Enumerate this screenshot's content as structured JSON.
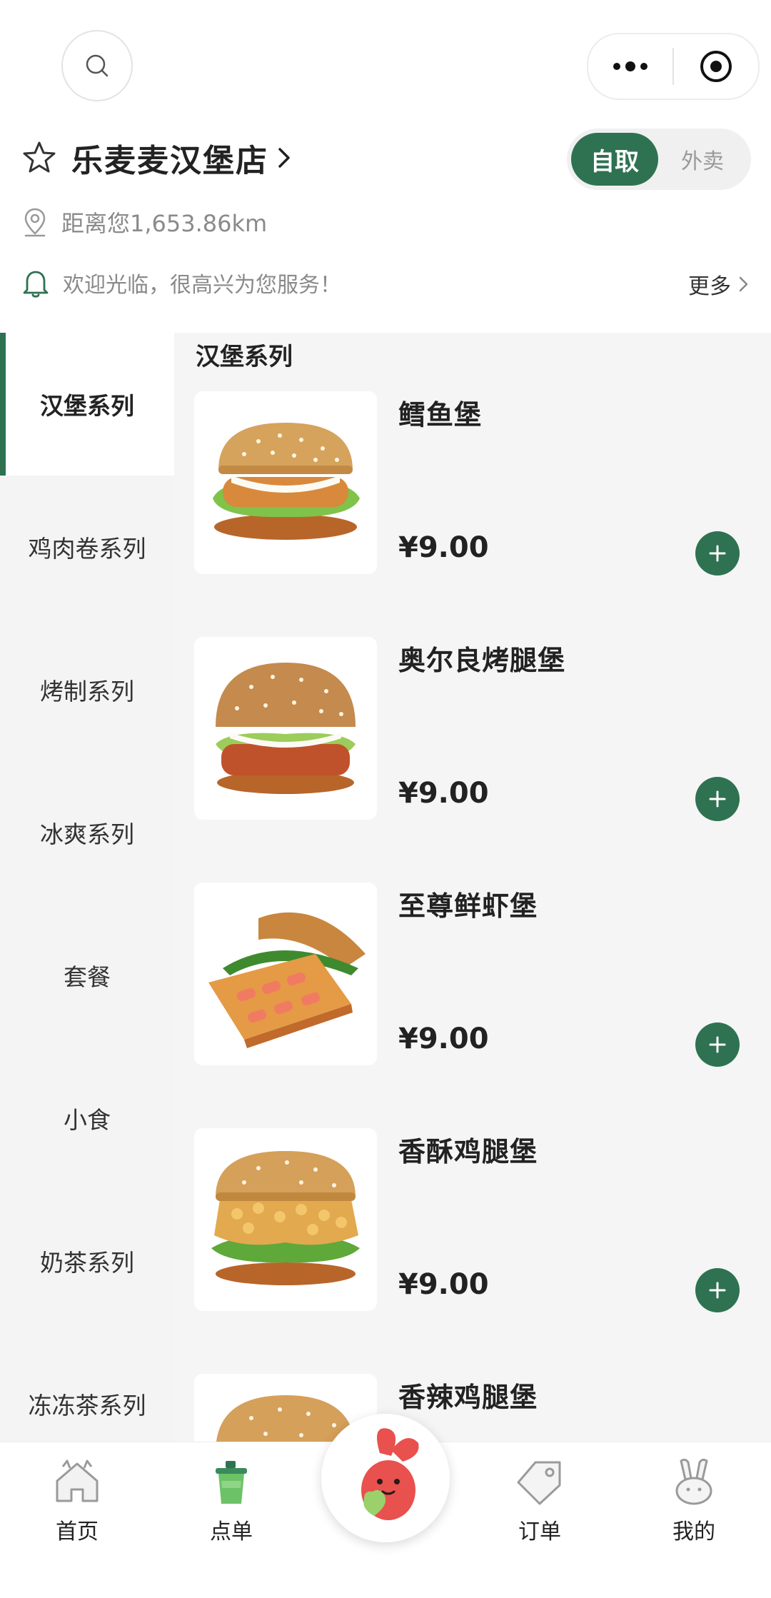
{
  "store": {
    "name": "乐麦麦汉堡店",
    "distance": "距离您1,653.86km",
    "notice": "欢迎光临，很高兴为您服务！",
    "more_label": "更多"
  },
  "mode_toggle": {
    "active": "自取",
    "inactive": "外卖"
  },
  "sidebar": {
    "categories": [
      {
        "label": "汉堡系列",
        "active": true
      },
      {
        "label": "鸡肉卷系列"
      },
      {
        "label": "烤制系列"
      },
      {
        "label": "冰爽系列"
      },
      {
        "label": "套餐"
      },
      {
        "label": "小食"
      },
      {
        "label": "奶茶系列"
      },
      {
        "label": "冻冻茶系列"
      }
    ]
  },
  "menu": {
    "section_title": "汉堡系列",
    "items": [
      {
        "name": "鳕鱼堡",
        "price": "¥9.00"
      },
      {
        "name": "奥尔良烤腿堡",
        "price": "¥9.00"
      },
      {
        "name": "至尊鲜虾堡",
        "price": "¥9.00"
      },
      {
        "name": "香酥鸡腿堡",
        "price": "¥9.00"
      },
      {
        "name": "香辣鸡腿堡",
        "price": ""
      }
    ]
  },
  "tabbar": {
    "tabs": [
      {
        "label": "首页",
        "icon": "home-icon"
      },
      {
        "label": "点单",
        "icon": "cup-icon"
      },
      {
        "label": "",
        "icon": "mascot-icon"
      },
      {
        "label": "订单",
        "icon": "tag-icon"
      },
      {
        "label": "我的",
        "icon": "rabbit-icon"
      }
    ]
  },
  "colors": {
    "accent": "#2e7252",
    "sidebar_bg": "#f4f4f4",
    "text_muted": "#8a8a8a"
  }
}
